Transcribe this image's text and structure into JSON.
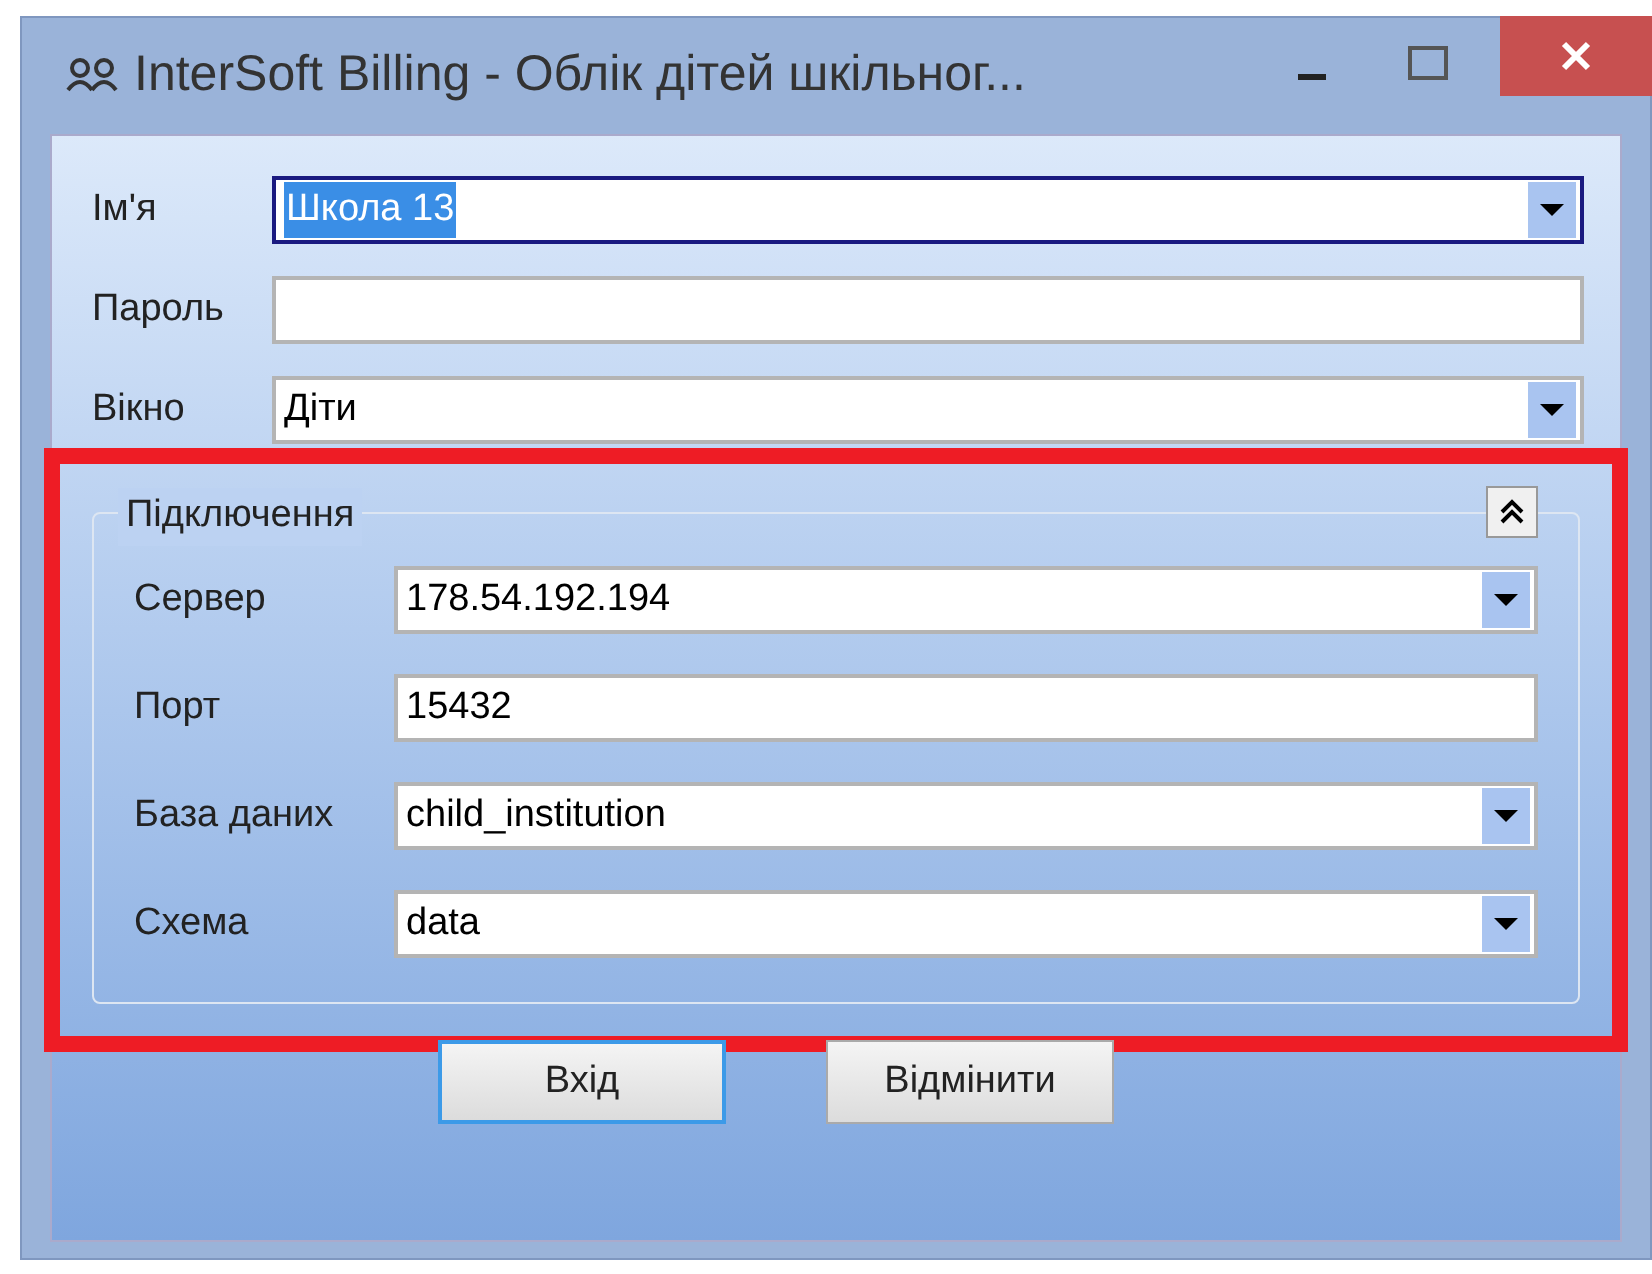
{
  "window": {
    "title": "InterSoft Billing - Облік дітей шкільног..."
  },
  "fields": [
    {
      "label": "Ім'я",
      "value": "Школа 13",
      "kind": "combo",
      "focused": true
    },
    {
      "label": "Пароль",
      "kind": "text",
      "focused": false
    },
    {
      "label": "Вікно",
      "value": "Діти",
      "kind": "combo",
      "focused": false
    }
  ],
  "connection": {
    "title": "Підключення",
    "expanded": true,
    "highlighted": true,
    "fields": [
      {
        "label": "Сервер",
        "value": "178.54.192.194",
        "kind": "combo"
      },
      {
        "label": "Порт",
        "value": "15432",
        "kind": "text"
      },
      {
        "label": "База даних",
        "value": "child_institution",
        "kind": "combo"
      },
      {
        "label": "Схема",
        "value": "data",
        "kind": "combo"
      }
    ]
  },
  "buttons": [
    {
      "label": "Вхід",
      "default": true
    },
    {
      "label": "Відмінити",
      "default": false
    }
  ]
}
